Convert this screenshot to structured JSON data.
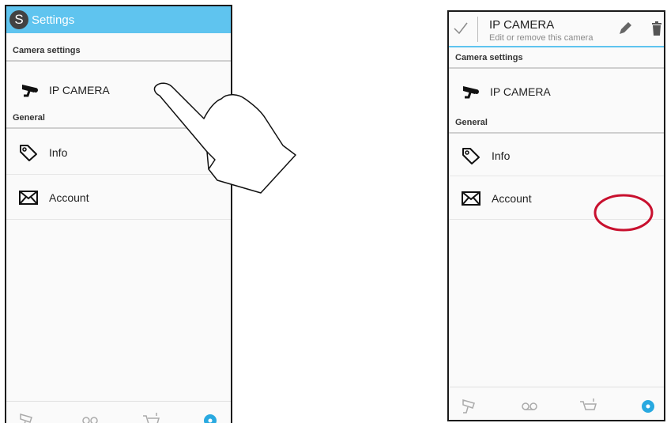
{
  "left": {
    "app_title": "Settings",
    "logo_letter": "S",
    "camera_section": "Camera settings",
    "camera_item": "IP CAMERA",
    "general_section": "General",
    "info_item": "Info",
    "account_item": "Account",
    "nav": [
      "camera-icon",
      "recordings-icon",
      "cart-icon",
      "settings-icon"
    ]
  },
  "right": {
    "context_title": "IP CAMERA",
    "context_subtitle": "Edit or remove this camera",
    "camera_section": "Camera settings",
    "camera_item": "IP CAMERA",
    "general_section": "General",
    "info_item": "Info",
    "account_item": "Account",
    "nav": [
      "camera-icon",
      "recordings-icon",
      "cart-icon",
      "settings-icon"
    ]
  },
  "colors": {
    "appbar": "#5fc4ef",
    "accent": "#29a9e0",
    "highlight_circle": "#c8102e"
  }
}
